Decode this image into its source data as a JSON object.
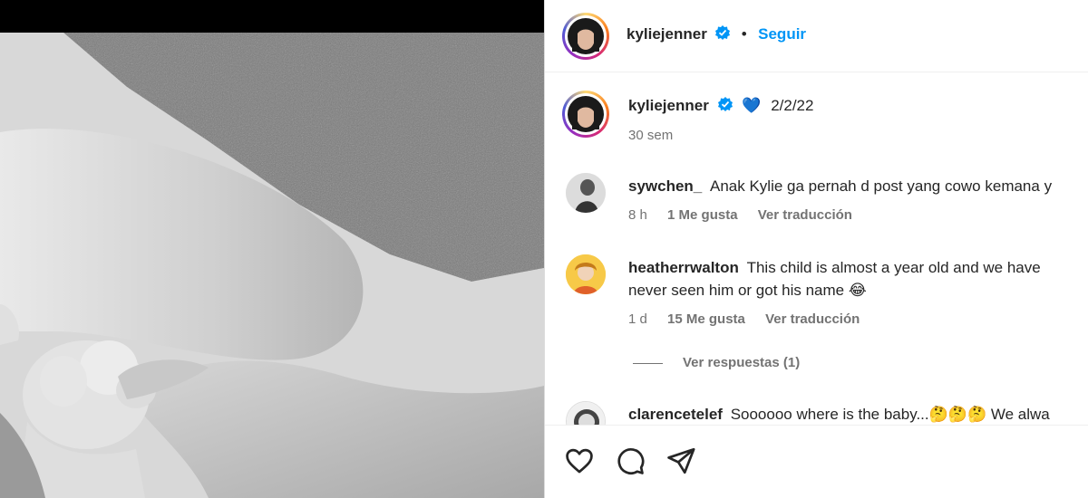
{
  "post": {
    "author": "kyliejenner",
    "follow_label": "Seguir",
    "separator": "•",
    "caption_emoji": "💙",
    "caption_text": "2/2/22",
    "time": "30 sem"
  },
  "comments": [
    {
      "user": "sywchen_",
      "text": "Anak Kylie ga pernah d post yang cowo kemana y",
      "time": "8 h",
      "likes": "1 Me gusta",
      "translate": "Ver traducción"
    },
    {
      "user": "heatherrwalton",
      "text_line1": "This child is almost a year old and we have",
      "text_line2": "never seen him or got his name 😂",
      "time": "1 d",
      "likes": "15 Me gusta",
      "translate": "Ver traducción",
      "replies": "Ver respuestas (1)"
    },
    {
      "user": "clarencetelef",
      "text": "Soooooo where is the baby...🤔🤔🤔 We alwa"
    }
  ],
  "colors": {
    "accent": "#0095f6",
    "verified": "#0095f6",
    "heart_emoji": "#1565c0"
  },
  "icons": [
    "heart-icon",
    "comment-icon",
    "share-icon",
    "verified-badge-icon"
  ]
}
